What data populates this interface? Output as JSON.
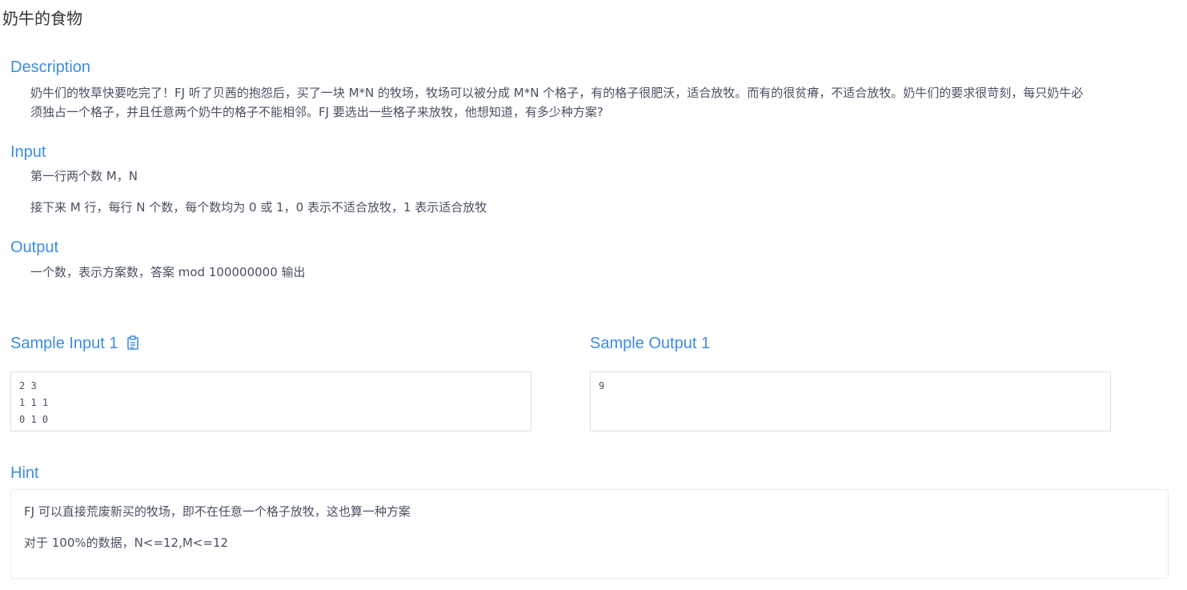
{
  "page": {
    "title": "奶牛的食物"
  },
  "description": {
    "heading": "Description",
    "line1": "奶牛们的牧草快要吃完了！FJ 听了贝茜的抱怨后，买了一块 M*N 的牧场，牧场可以被分成 M*N 个格子，有的格子很肥沃，适合放牧。而有的很贫瘠，不适合放牧。奶牛们的要求很苛刻，每只奶牛必",
    "line2": "须独占一个格子，并且任意两个奶牛的格子不能相邻。FJ 要选出一些格子来放牧，他想知道，有多少种方案?"
  },
  "input": {
    "heading": "Input",
    "line1": "第一行两个数 M，N",
    "line2": "接下来 M 行，每行 N 个数，每个数均为 0 或 1，0 表示不适合放牧，1 表示适合放牧"
  },
  "output": {
    "heading": "Output",
    "line1": "一个数，表示方案数，答案 mod 100000000 输出"
  },
  "sample_input": {
    "heading": "Sample Input 1",
    "copy_icon": "clipboard-icon",
    "content": "2 3\n1 1 1\n0 1 0"
  },
  "sample_output": {
    "heading": "Sample Output 1",
    "content": "9"
  },
  "hint": {
    "heading": "Hint",
    "line1": "FJ 可以直接荒废新买的牧场，即不在任意一个格子放牧，这也算一种方案",
    "line2": "对于 100%的数据，N<=12,M<=12"
  },
  "colors": {
    "accent": "#3c8ce7",
    "text": "#495060",
    "border": "#dcdee2"
  }
}
